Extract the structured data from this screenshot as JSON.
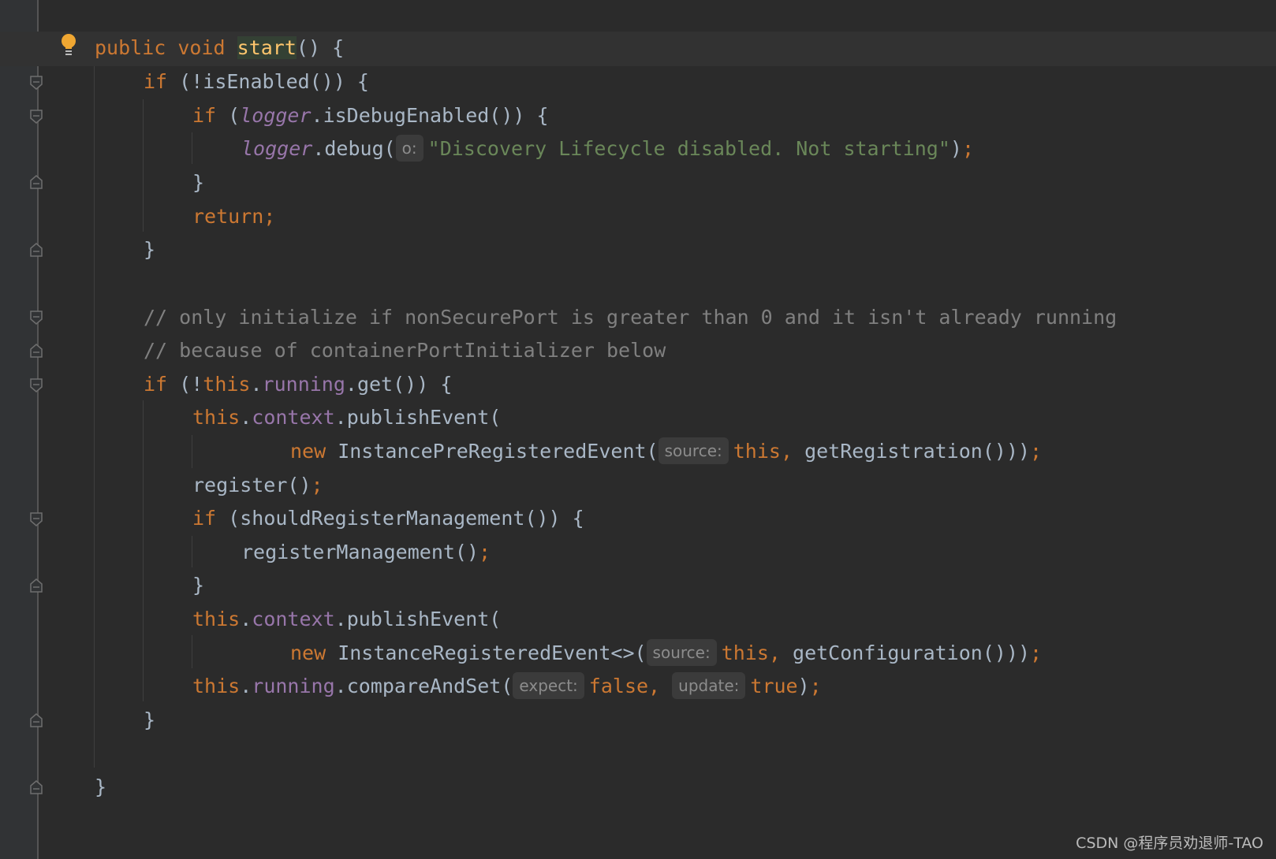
{
  "code": {
    "l1_public": "public",
    "l1_void": "void",
    "l1_method": "start",
    "l1_rest": "() {",
    "l2_if": "if",
    "l2_rest": " (!isEnabled()) {",
    "l3_if": "if",
    "l3_open": " (",
    "l3_logger": "logger",
    "l3_rest": ".isDebugEnabled()) {",
    "l4_logger": "logger",
    "l4_call": ".debug(",
    "l4_hint": "o:",
    "l4_str": "\"Discovery Lifecycle disabled. Not starting\"",
    "l4_close": ")",
    "l4_semi": ";",
    "l5_brace": "}",
    "l6_return": "return;",
    "l7_brace": "}",
    "l8_comment": "// only initialize if nonSecurePort is greater than 0 and it isn't already running",
    "l9_comment": "// because of containerPortInitializer below",
    "l10_if": "if",
    "l10_open": " (!",
    "l10_this": "this",
    "l10_dot": ".",
    "l10_running": "running",
    "l10_rest": ".get()) {",
    "l11_this": "this",
    "l11_dot": ".",
    "l11_context": "context",
    "l11_rest": ".publishEvent(",
    "l12_new": "new",
    "l12_cls": " InstancePreRegisteredEvent(",
    "l12_hint": "source:",
    "l12_this": "this,",
    "l12_rest": " getRegistration()))",
    "l12_semi": ";",
    "l13_call": "register()",
    "l13_semi": ";",
    "l14_if": "if",
    "l14_rest": " (shouldRegisterManagement()) {",
    "l15_call": "registerManagement()",
    "l15_semi": ";",
    "l16_brace": "}",
    "l17_this": "this",
    "l17_dot": ".",
    "l17_context": "context",
    "l17_rest": ".publishEvent(",
    "l18_new": "new",
    "l18_cls": " InstanceRegisteredEvent<>(",
    "l18_hint": "source:",
    "l18_this": "this,",
    "l18_rest": " getConfiguration()))",
    "l18_semi": ";",
    "l19_this": "this",
    "l19_dot": ".",
    "l19_running": "running",
    "l19_rest": ".compareAndSet(",
    "l19_hint1": "expect:",
    "l19_false": "false,",
    "l19_hint2": "update:",
    "l19_true": "true",
    "l19_close": ")",
    "l19_semi": ";",
    "l20_brace": "}",
    "l21_brace": "}"
  },
  "watermark": "CSDN @程序员劝退师-TAO",
  "icons": {
    "intention": "lightbulb-icon",
    "fold": "fold-marker-icon"
  },
  "colors": {
    "background": "#2b2b2b",
    "keyword": "#cc7832",
    "field": "#9876aa",
    "string": "#6a8759",
    "comment": "#808080",
    "text": "#a9b7c6",
    "method_decl": "#ffc66d"
  }
}
